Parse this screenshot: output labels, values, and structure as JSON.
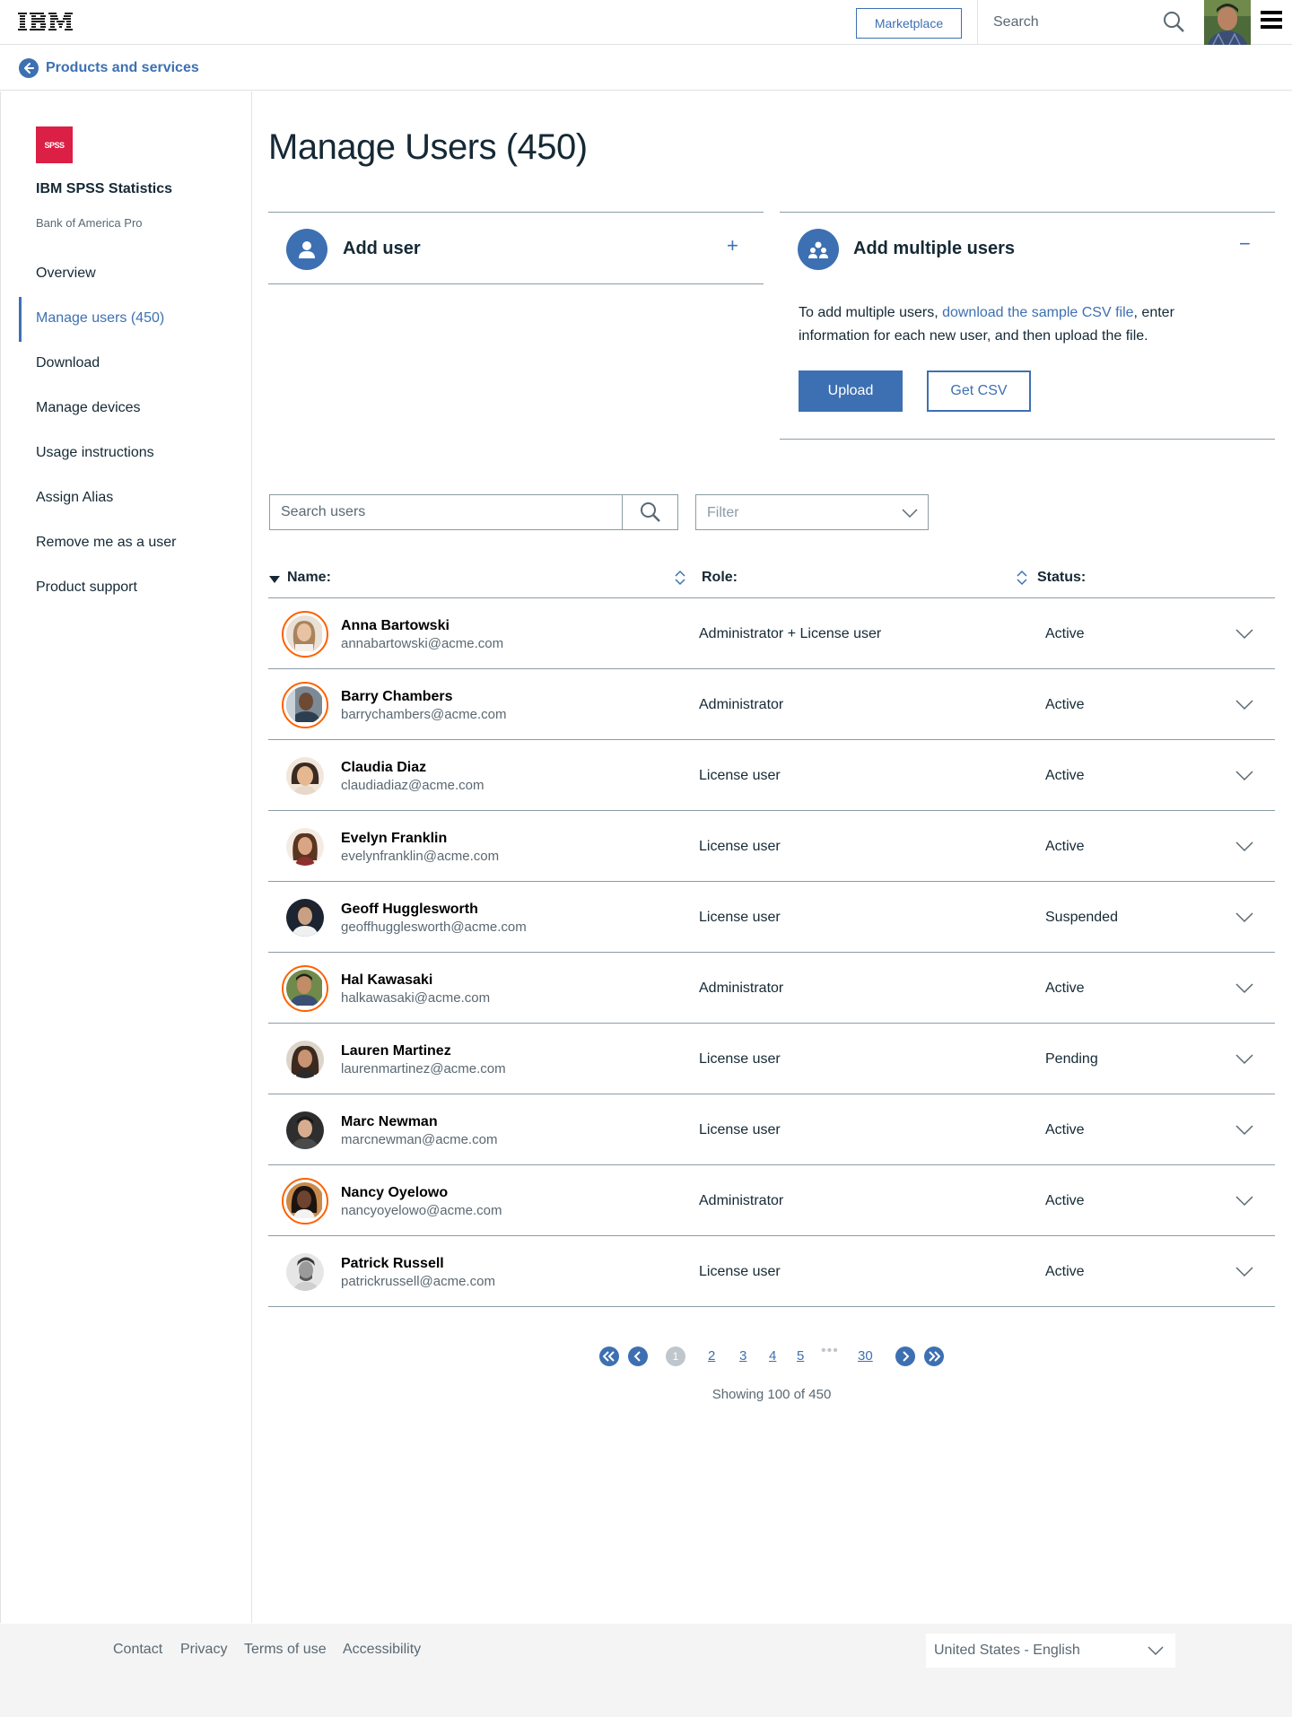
{
  "masthead": {
    "logo_text": "IBM",
    "marketplace_label": "Marketplace",
    "search_placeholder": "Search"
  },
  "breadcrumb": {
    "label": "Products and services"
  },
  "sidebar": {
    "logo_text": "SPSS",
    "product_name": "IBM SPSS Statistics",
    "account": "Bank of America Pro",
    "items": [
      {
        "label": "Overview"
      },
      {
        "label": "Manage users (450)",
        "active": true
      },
      {
        "label": "Download"
      },
      {
        "label": "Manage devices"
      },
      {
        "label": "Usage instructions"
      },
      {
        "label": "Assign Alias"
      },
      {
        "label": "Remove me as a user"
      },
      {
        "label": "Product support"
      }
    ]
  },
  "main": {
    "title": "Manage Users (450)",
    "add_user": {
      "title": "Add user",
      "toggle": "+"
    },
    "add_multiple": {
      "title": "Add multiple users",
      "toggle": "−",
      "desc_before": "To add multiple users, ",
      "desc_link": "download the sample CSV file",
      "desc_after": ", enter information for each new user, and then upload the file.",
      "upload_label": "Upload",
      "csv_label": "Get CSV"
    },
    "search_placeholder": "Search users",
    "filter_placeholder": "Filter"
  },
  "table": {
    "headers": {
      "name": "Name:",
      "role": "Role:",
      "status": "Status:"
    },
    "rows": [
      {
        "name": "Anna Bartowski",
        "email": "annabartowski@acme.com",
        "role": "Administrator + License user",
        "status": "Active",
        "admin": true
      },
      {
        "name": "Barry Chambers",
        "email": "barrychambers@acme.com",
        "role": "Administrator",
        "status": "Active",
        "admin": true
      },
      {
        "name": "Claudia Diaz",
        "email": "claudiadiaz@acme.com",
        "role": "License user",
        "status": "Active",
        "admin": false
      },
      {
        "name": "Evelyn Franklin",
        "email": "evelynfranklin@acme.com",
        "role": "License user",
        "status": "Active",
        "admin": false
      },
      {
        "name": "Geoff Hugglesworth",
        "email": "geoffhugglesworth@acme.com",
        "role": "License user",
        "status": "Suspended",
        "admin": false
      },
      {
        "name": "Hal Kawasaki",
        "email": "halkawasaki@acme.com",
        "role": "Administrator",
        "status": "Active",
        "admin": true
      },
      {
        "name": "Lauren Martinez",
        "email": "laurenmartinez@acme.com",
        "role": "License user",
        "status": "Pending",
        "admin": false
      },
      {
        "name": "Marc Newman",
        "email": "marcnewman@acme.com",
        "role": "License user",
        "status": "Active",
        "admin": false
      },
      {
        "name": "Nancy Oyelowo",
        "email": "nancyoyelowo@acme.com",
        "role": "Administrator",
        "status": "Active",
        "admin": true
      },
      {
        "name": "Patrick Russell",
        "email": "patrickrussell@acme.com",
        "role": "License user",
        "status": "Active",
        "admin": false
      }
    ]
  },
  "pagination": {
    "current": "1",
    "pages": [
      "2",
      "3",
      "4",
      "5"
    ],
    "dots": "•••",
    "last": "30",
    "showing": "Showing 100 of 450"
  },
  "footer": {
    "links": [
      "Contact",
      "Privacy",
      "Terms of use",
      "Accessibility"
    ],
    "language": "United States - English"
  },
  "colors": {
    "accent": "#3d70b2",
    "admin_ring": "#fe6100",
    "brand_red": "#dc1f45",
    "text": "#152935",
    "muted": "#5a6872"
  }
}
